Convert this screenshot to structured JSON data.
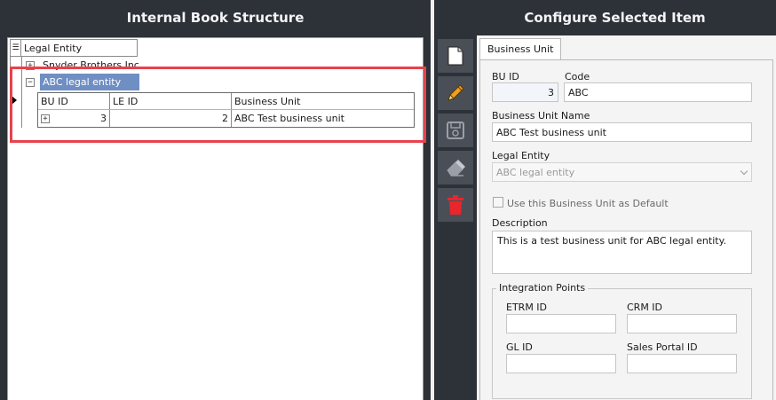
{
  "left_panel": {
    "title": "Internal Book Structure",
    "grid_header": "Legal Entity",
    "entities": [
      {
        "label": "Snyder Brothers Inc",
        "expanded": false
      },
      {
        "label": "ABC legal entity",
        "expanded": true
      }
    ],
    "sub_grid": {
      "columns": [
        "BU ID",
        "LE ID",
        "Business Unit"
      ],
      "rows": [
        {
          "bu_id": "3",
          "le_id": "2",
          "business_unit": "ABC Test business unit"
        }
      ]
    }
  },
  "right_panel": {
    "title": "Configure Selected Item",
    "toolbar": [
      "new-document-icon",
      "edit-pencil-icon",
      "save-floppy-icon",
      "eraser-icon",
      "delete-trash-icon"
    ],
    "tab_label": "Business Unit",
    "form": {
      "bu_id_label": "BU ID",
      "bu_id_value": "3",
      "code_label": "Code",
      "code_value": "ABC",
      "bu_name_label": "Business Unit Name",
      "bu_name_value": "ABC Test business unit",
      "legal_entity_label": "Legal Entity",
      "legal_entity_value": "ABC legal entity",
      "default_checkbox_label": "Use this Business Unit as Default",
      "default_checked": false,
      "description_label": "Description",
      "description_value": "This is a test business unit for ABC legal entity.",
      "integration_title": "Integration Points",
      "etrm_label": "ETRM ID",
      "etrm_value": "",
      "crm_label": "CRM ID",
      "crm_value": "",
      "gl_label": "GL ID",
      "gl_value": "",
      "sales_portal_label": "Sales Portal ID",
      "sales_portal_value": ""
    }
  },
  "colors": {
    "panel_bg": "#2d3138",
    "selected_row": "#6f8fc4",
    "highlight_border": "#e8424c",
    "delete_icon": "#e8262c"
  }
}
